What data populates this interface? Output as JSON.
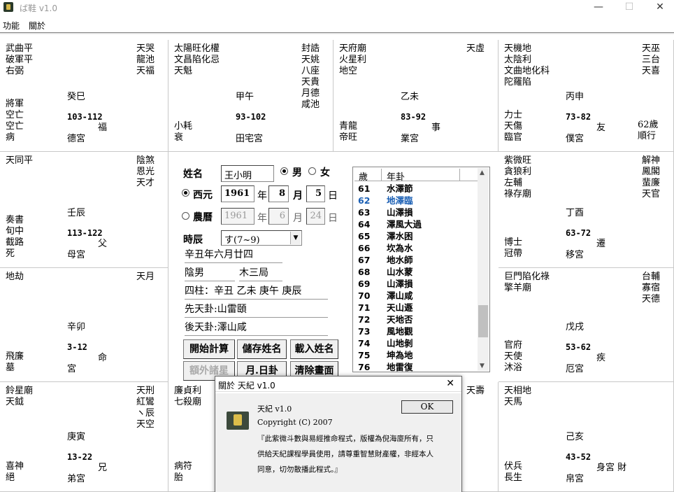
{
  "window": {
    "title": "ば鞋 v1.0",
    "min": "—",
    "max": "☐",
    "close": "✕"
  },
  "menu": [
    "功能",
    "關於"
  ],
  "palaces": [
    {
      "id": "si",
      "stars": [
        "武曲平",
        "破軍平",
        "右弼"
      ],
      "minor": [
        "天哭",
        "龍池",
        "天福"
      ],
      "bottom": [
        "將軍",
        "空亡",
        "空亡",
        "病"
      ],
      "gz": "癸巳",
      "age": "103-112",
      "rel": "福",
      "palace": "德宮"
    },
    {
      "id": "wu",
      "stars": [
        "太陽旺化權",
        "文昌陷化忌",
        "天魁"
      ],
      "minor": [
        "封誥",
        "天姚",
        "八座",
        "天貴",
        "月德",
        "咸池"
      ],
      "bottom": [
        "小耗",
        "衰"
      ],
      "gz": "甲午",
      "age": "93-102",
      "rel": "",
      "palace": "田宅宮"
    },
    {
      "id": "wei",
      "stars": [
        "天府廟",
        "火星利",
        "地空"
      ],
      "minor": [
        "天虛"
      ],
      "bottom": [
        "青龍",
        "帝旺"
      ],
      "gz": "乙未",
      "age": "83-92",
      "rel": "事",
      "palace": "業宮"
    },
    {
      "id": "shen",
      "stars": [
        "天機地",
        "太陰利",
        "文曲地化科",
        "陀羅陷"
      ],
      "minor": [
        "天巫",
        "三台",
        "天喜"
      ],
      "bottom": [
        "力士",
        "天傷",
        "臨官"
      ],
      "gz": "丙申",
      "age": "73-82",
      "rel": "友",
      "palace": "僕宮",
      "side": [
        "62歲",
        "順行"
      ]
    },
    {
      "id": "chen",
      "stars": [
        "天同平"
      ],
      "minor": [
        "陰煞",
        "恩光",
        "天才"
      ],
      "bottom": [
        "奏書",
        "旬中",
        "截路",
        "死"
      ],
      "gz": "壬辰",
      "age": "113-122",
      "rel": "父",
      "palace": "母宮"
    },
    {
      "id": "you",
      "stars": [
        "紫微旺",
        "貪狼利",
        "左輔",
        "祿存廟"
      ],
      "minor": [
        "解神",
        "鳳閣",
        "蜚廉",
        "天官"
      ],
      "bottom": [
        "博士",
        "冠帶"
      ],
      "gz": "丁酉",
      "age": "63-72",
      "rel": "遷",
      "palace": "移宮"
    },
    {
      "id": "mao",
      "stars": [
        "地劫"
      ],
      "minor": [
        "天月"
      ],
      "bottom": [
        "飛廉",
        "墓"
      ],
      "gz": "辛卯",
      "age": "3-12",
      "rel": "命",
      "palace": "宮"
    },
    {
      "id": "xu",
      "stars": [
        "巨門陷化祿",
        "擎羊廟"
      ],
      "minor": [
        "台輔",
        "寡宿",
        "天德"
      ],
      "bottom": [
        "官府",
        "天使",
        "沐浴"
      ],
      "gz": "戊戌",
      "age": "53-62",
      "rel": "疾",
      "palace": "厄宮"
    },
    {
      "id": "yin",
      "stars": [
        "鈴星廟",
        "天鉞"
      ],
      "minor": [
        "天刑",
        "紅鸞",
        "ヽ辰",
        "天空"
      ],
      "bottom": [
        "喜神",
        "絕"
      ],
      "gz": "庚寅",
      "age": "13-22",
      "rel": "兄",
      "palace": "弟宮"
    },
    {
      "id": "chou",
      "stars": [
        "廉貞利",
        "七殺廟"
      ],
      "minor": [],
      "bottom": [
        "病符",
        "胎"
      ],
      "gz": "",
      "age": "",
      "rel": "",
      "palace": ""
    },
    {
      "id": "zi",
      "stars": [],
      "minor": [
        "天壽"
      ],
      "bottom": [],
      "gz": "",
      "age": "",
      "rel": "",
      "palace": ""
    },
    {
      "id": "hai",
      "stars": [
        "天相地",
        "天馬"
      ],
      "minor": [],
      "bottom": [
        "伏兵",
        "長生"
      ],
      "gz": "己亥",
      "age": "43-52",
      "rel": "身宮 財",
      "palace": "帛宮"
    }
  ],
  "form": {
    "name_label": "姓名",
    "name_value": "王小明",
    "male": "男",
    "female": "女",
    "western": "西元",
    "lunar": "農曆",
    "w_year": "1961",
    "w_month": "8",
    "w_day": "5",
    "l_year": "1961",
    "l_month": "6",
    "l_day": "24",
    "year_unit": "年",
    "month_unit": "月",
    "day_unit": "日",
    "hour_label": "時辰",
    "hour_value": "す(7~9)",
    "f1": "辛丑年六月廿四",
    "f2a": "陰男",
    "f2b": "木三局",
    "f3": "四柱：辛丑 乙未 庚午 庚辰",
    "f4": "先天卦:山雷頤",
    "f5": "後天卦:澤山咸"
  },
  "buttons": {
    "calc": "開始計算",
    "save": "儲存姓名",
    "load": "載入姓名",
    "extra": "額外諸星",
    "month": "月.日卦",
    "clear": "清除畫面"
  },
  "list": {
    "col1": "歲",
    "col2": "年卦",
    "rows": [
      [
        "61",
        "水澤節"
      ],
      [
        "62",
        "地澤臨"
      ],
      [
        "63",
        "山澤損"
      ],
      [
        "64",
        "澤風大過"
      ],
      [
        "65",
        "澤水困"
      ],
      [
        "66",
        "坎為水"
      ],
      [
        "67",
        "地水師"
      ],
      [
        "68",
        "山水蒙"
      ],
      [
        "69",
        "山澤損"
      ],
      [
        "70",
        "澤山咸"
      ],
      [
        "71",
        "天山遯"
      ],
      [
        "72",
        "天地否"
      ],
      [
        "73",
        "風地觀"
      ],
      [
        "74",
        "山地剝"
      ],
      [
        "75",
        "坤為地"
      ],
      [
        "76",
        "地雷復"
      ]
    ],
    "selected": "62",
    "selected_color": "#1a5fb4"
  },
  "dialog": {
    "title": "關於 天紀 v1.0",
    "close": "✕",
    "name": "天紀 v1.0",
    "copyright": "Copyright (C) 2007",
    "ok": "OK",
    "desc1": "『此紫微斗數與易經推命程式，版權為倪海廈所有，只",
    "desc2": "供給天紀課程學員使用，請尊重智慧財產權，非經本人",
    "desc3": "同意，切勿散播此程式。』"
  }
}
